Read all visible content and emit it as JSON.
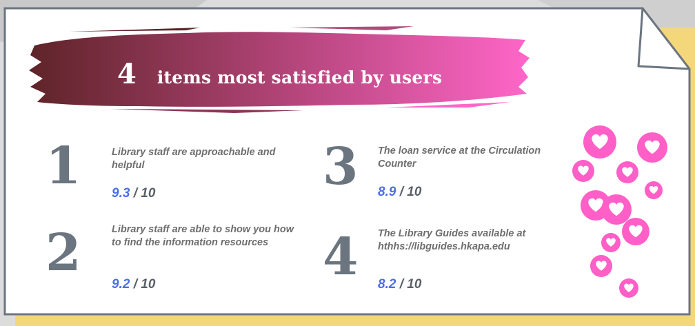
{
  "banner": {
    "count": "4",
    "title": "items most satisfied by users"
  },
  "items": [
    {
      "rank": "1",
      "text": "Library staff are approachable and helpful",
      "score": "9.3",
      "out_of": " / 10"
    },
    {
      "rank": "2",
      "text": "Library staff are able to show you how to find the information resources",
      "score": "9.2",
      "out_of": " / 10"
    },
    {
      "rank": "3",
      "text": "The loan service at the Circulation Counter",
      "score": "8.9",
      "out_of": " / 10"
    },
    {
      "rank": "4",
      "text": "The Library Guides available at hthhs://libguides.hkapa.edu",
      "score": "8.2",
      "out_of": " / 10"
    }
  ],
  "colors": {
    "accent_pink": "#ff5fc7",
    "banner_dark": "#6b2a2e",
    "score_blue": "#4a6ee8",
    "number_gray": "#6b7580"
  },
  "decor": {
    "icon": "heart-bubbles-icon"
  }
}
